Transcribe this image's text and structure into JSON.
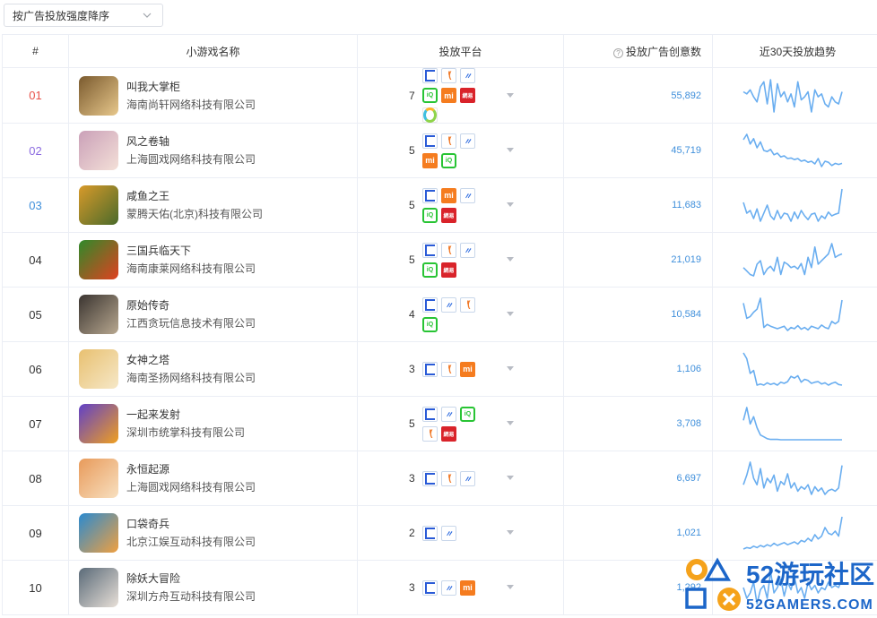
{
  "sort": {
    "label": "按广告投放强度降序"
  },
  "table": {
    "headers": {
      "rank": "#",
      "name": "小游戏名称",
      "platform": "投放平台",
      "creatives": "投放广告创意数",
      "trend": "近30天投放趋势"
    },
    "rows": [
      {
        "rank": "01",
        "name": "叫我大掌柜",
        "company": "海南尚轩网络科技有限公司",
        "platform_count": "7",
        "platforms": [
          "toutiao-icon",
          "kuaishou-icon",
          "weibo-icon",
          "iqiyi-icon",
          "xiaomi-icon",
          "netease-icon",
          "pinwheel-icon"
        ],
        "creatives": "55,892",
        "trend": [
          60,
          58,
          62,
          55,
          50,
          65,
          70,
          48,
          72,
          40,
          68,
          55,
          60,
          50,
          58,
          45,
          70,
          52,
          55,
          60,
          40,
          62,
          55,
          58,
          48,
          45,
          55,
          50,
          48,
          60
        ]
      },
      {
        "rank": "02",
        "name": "风之卷轴",
        "company": "上海圆戏网络科技有限公司",
        "platform_count": "5",
        "platforms": [
          "toutiao-icon",
          "kuaishou-icon",
          "weibo-icon",
          "xiaomi-icon",
          "iqiyi-icon"
        ],
        "creatives": "45,719",
        "trend": [
          70,
          80,
          62,
          72,
          55,
          66,
          50,
          48,
          52,
          42,
          45,
          38,
          40,
          35,
          36,
          33,
          35,
          30,
          32,
          28,
          30,
          25,
          35,
          20,
          30,
          28,
          22,
          26,
          24,
          26
        ]
      },
      {
        "rank": "03",
        "name": "咸鱼之王",
        "company": "蒙腾天佑(北京)科技有限公司",
        "platform_count": "5",
        "platforms": [
          "toutiao-icon",
          "xiaomi-icon",
          "weibo-icon",
          "iqiyi-icon",
          "netease-icon"
        ],
        "creatives": "11,683",
        "trend": [
          60,
          40,
          45,
          30,
          48,
          25,
          40,
          55,
          35,
          28,
          45,
          30,
          40,
          38,
          25,
          42,
          30,
          45,
          35,
          28,
          38,
          40,
          25,
          35,
          30,
          42,
          35,
          38,
          40,
          85
        ]
      },
      {
        "rank": "04",
        "name": "三国兵临天下",
        "company": "海南康莱网络科技有限公司",
        "platform_count": "5",
        "platforms": [
          "toutiao-icon",
          "kuaishou-icon",
          "weibo-icon",
          "iqiyi-icon",
          "netease-icon"
        ],
        "creatives": "21,019",
        "trend": [
          40,
          35,
          30,
          28,
          45,
          50,
          30,
          38,
          42,
          35,
          55,
          30,
          48,
          45,
          40,
          42,
          38,
          46,
          30,
          55,
          40,
          70,
          45,
          50,
          55,
          60,
          75,
          55,
          58,
          60
        ]
      },
      {
        "rank": "05",
        "name": "原始传奇",
        "company": "江西贪玩信息技术有限公司",
        "platform_count": "4",
        "platforms": [
          "toutiao-icon",
          "weibo-icon",
          "kuaishou-icon",
          "iqiyi-icon"
        ],
        "creatives": "10,584",
        "trend": [
          70,
          45,
          48,
          55,
          60,
          78,
          30,
          35,
          32,
          30,
          28,
          30,
          32,
          25,
          30,
          28,
          33,
          27,
          30,
          26,
          32,
          30,
          28,
          34,
          30,
          28,
          40,
          36,
          40,
          75
        ]
      },
      {
        "rank": "06",
        "name": "女神之塔",
        "company": "海南圣扬网络科技有限公司",
        "platform_count": "3",
        "platforms": [
          "toutiao-icon",
          "kuaishou-icon",
          "xiaomi-icon"
        ],
        "creatives": "1,106",
        "trend": [
          85,
          75,
          50,
          55,
          30,
          32,
          30,
          34,
          31,
          33,
          30,
          35,
          33,
          36,
          45,
          42,
          46,
          35,
          40,
          38,
          33,
          35,
          36,
          32,
          34,
          30,
          33,
          35,
          31,
          30
        ]
      },
      {
        "rank": "07",
        "name": "一起来发射",
        "company": "深圳市统掌科技有限公司",
        "platform_count": "5",
        "platforms": [
          "toutiao-icon",
          "weibo-icon",
          "iqiyi-icon",
          "kuaishou-icon",
          "netease-icon"
        ],
        "creatives": "3,708",
        "trend": [
          60,
          95,
          50,
          70,
          40,
          20,
          15,
          10,
          8,
          8,
          8,
          7,
          7,
          7,
          7,
          7,
          7,
          7,
          7,
          7,
          7,
          7,
          7,
          7,
          7,
          7,
          7,
          7,
          7,
          7
        ]
      },
      {
        "rank": "08",
        "name": "永恒起源",
        "company": "上海圆戏网络科技有限公司",
        "platform_count": "3",
        "platforms": [
          "toutiao-icon",
          "kuaishou-icon",
          "weibo-icon"
        ],
        "creatives": "6,697",
        "trend": [
          45,
          60,
          80,
          55,
          45,
          70,
          40,
          55,
          48,
          60,
          35,
          50,
          45,
          62,
          40,
          48,
          35,
          42,
          38,
          45,
          30,
          42,
          35,
          40,
          30,
          36,
          38,
          35,
          40,
          75
        ]
      },
      {
        "rank": "09",
        "name": "口袋奇兵",
        "company": "北京江娱互动科技有限公司",
        "platform_count": "2",
        "platforms": [
          "toutiao-icon",
          "weibo-icon"
        ],
        "creatives": "1,021",
        "trend": [
          10,
          12,
          11,
          14,
          12,
          15,
          13,
          16,
          14,
          18,
          15,
          17,
          19,
          16,
          18,
          20,
          17,
          22,
          20,
          25,
          21,
          30,
          24,
          28,
          40,
          32,
          30,
          35,
          28,
          55
        ]
      },
      {
        "rank": "10",
        "name": "除妖大冒险",
        "company": "深圳方舟互动科技有限公司",
        "platform_count": "3",
        "platforms": [
          "toutiao-icon",
          "weibo-icon",
          "xiaomi-icon"
        ],
        "creatives": "1,292",
        "trend": [
          40,
          30,
          35,
          45,
          25,
          38,
          42,
          30,
          55,
          35,
          40,
          48,
          32,
          45,
          38,
          50,
          35,
          40,
          30,
          45,
          38,
          42,
          35,
          40,
          38,
          45,
          40,
          42,
          40,
          48
        ]
      }
    ]
  },
  "platform_glyphs": {
    "toutiao-icon": "",
    "kuaishou-icon": "ᑊᑊ(",
    "weibo-icon": "〃",
    "iqiyi-icon": "iQ",
    "xiaomi-icon": "mi",
    "netease-icon": "網易",
    "pinwheel-icon": ""
  },
  "watermark": {
    "brand": "52游玩社区",
    "domain": "52GAMERS.COM"
  }
}
